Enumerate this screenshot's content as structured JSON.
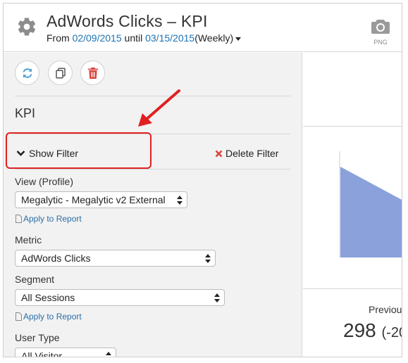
{
  "header": {
    "title": "AdWords Clicks – KPI",
    "from_text": "From",
    "start_date": "02/09/2015",
    "until_text": "until",
    "end_date": "03/15/2015",
    "interval": "(Weekly)",
    "png_label": "PNG"
  },
  "toolbar": {
    "buttons": [
      "refresh-icon",
      "copy-icon",
      "trash-icon"
    ]
  },
  "panel": {
    "widget_title": "KPI",
    "show_filter_label": "Show Filter",
    "delete_filter_label": "Delete Filter",
    "view_label": "View (Profile)",
    "view_value": "Megalytic - Megalytic v2 External",
    "apply_to_report_1": "Apply to Report",
    "metric_label": "Metric",
    "metric_value": "AdWords Clicks",
    "segment_label": "Segment",
    "segment_value": "All Sessions",
    "apply_to_report_2": "Apply to Report",
    "user_type_label": "User Type",
    "user_type_value": "All Visitor"
  },
  "preview": {
    "previous_label": "Previou",
    "previous_value": "298",
    "previous_delta": "(-20"
  },
  "colors": {
    "accent_blue": "#1a73b5",
    "link_blue": "#2a6fa8",
    "refresh_blue": "#4a9fd8",
    "trash_red": "#d9463e",
    "delete_red": "#d9463e",
    "annotation_red": "#e02020",
    "chart_fill": "#8aa1dc"
  }
}
